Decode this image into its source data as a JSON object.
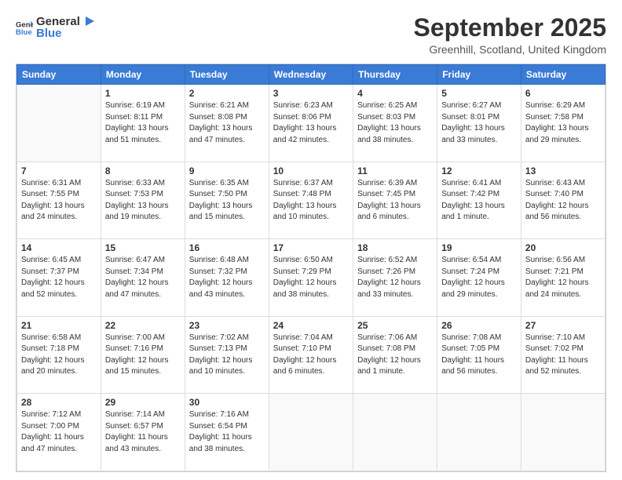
{
  "header": {
    "logo_general": "General",
    "logo_blue": "Blue",
    "title": "September 2025",
    "subtitle": "Greenhill, Scotland, United Kingdom"
  },
  "days": [
    "Sunday",
    "Monday",
    "Tuesday",
    "Wednesday",
    "Thursday",
    "Friday",
    "Saturday"
  ],
  "weeks": [
    [
      {
        "num": "",
        "sunrise": "",
        "sunset": "",
        "daylight": ""
      },
      {
        "num": "1",
        "sunrise": "Sunrise: 6:19 AM",
        "sunset": "Sunset: 8:11 PM",
        "daylight": "Daylight: 13 hours and 51 minutes."
      },
      {
        "num": "2",
        "sunrise": "Sunrise: 6:21 AM",
        "sunset": "Sunset: 8:08 PM",
        "daylight": "Daylight: 13 hours and 47 minutes."
      },
      {
        "num": "3",
        "sunrise": "Sunrise: 6:23 AM",
        "sunset": "Sunset: 8:06 PM",
        "daylight": "Daylight: 13 hours and 42 minutes."
      },
      {
        "num": "4",
        "sunrise": "Sunrise: 6:25 AM",
        "sunset": "Sunset: 8:03 PM",
        "daylight": "Daylight: 13 hours and 38 minutes."
      },
      {
        "num": "5",
        "sunrise": "Sunrise: 6:27 AM",
        "sunset": "Sunset: 8:01 PM",
        "daylight": "Daylight: 13 hours and 33 minutes."
      },
      {
        "num": "6",
        "sunrise": "Sunrise: 6:29 AM",
        "sunset": "Sunset: 7:58 PM",
        "daylight": "Daylight: 13 hours and 29 minutes."
      }
    ],
    [
      {
        "num": "7",
        "sunrise": "Sunrise: 6:31 AM",
        "sunset": "Sunset: 7:55 PM",
        "daylight": "Daylight: 13 hours and 24 minutes."
      },
      {
        "num": "8",
        "sunrise": "Sunrise: 6:33 AM",
        "sunset": "Sunset: 7:53 PM",
        "daylight": "Daylight: 13 hours and 19 minutes."
      },
      {
        "num": "9",
        "sunrise": "Sunrise: 6:35 AM",
        "sunset": "Sunset: 7:50 PM",
        "daylight": "Daylight: 13 hours and 15 minutes."
      },
      {
        "num": "10",
        "sunrise": "Sunrise: 6:37 AM",
        "sunset": "Sunset: 7:48 PM",
        "daylight": "Daylight: 13 hours and 10 minutes."
      },
      {
        "num": "11",
        "sunrise": "Sunrise: 6:39 AM",
        "sunset": "Sunset: 7:45 PM",
        "daylight": "Daylight: 13 hours and 6 minutes."
      },
      {
        "num": "12",
        "sunrise": "Sunrise: 6:41 AM",
        "sunset": "Sunset: 7:42 PM",
        "daylight": "Daylight: 13 hours and 1 minute."
      },
      {
        "num": "13",
        "sunrise": "Sunrise: 6:43 AM",
        "sunset": "Sunset: 7:40 PM",
        "daylight": "Daylight: 12 hours and 56 minutes."
      }
    ],
    [
      {
        "num": "14",
        "sunrise": "Sunrise: 6:45 AM",
        "sunset": "Sunset: 7:37 PM",
        "daylight": "Daylight: 12 hours and 52 minutes."
      },
      {
        "num": "15",
        "sunrise": "Sunrise: 6:47 AM",
        "sunset": "Sunset: 7:34 PM",
        "daylight": "Daylight: 12 hours and 47 minutes."
      },
      {
        "num": "16",
        "sunrise": "Sunrise: 6:48 AM",
        "sunset": "Sunset: 7:32 PM",
        "daylight": "Daylight: 12 hours and 43 minutes."
      },
      {
        "num": "17",
        "sunrise": "Sunrise: 6:50 AM",
        "sunset": "Sunset: 7:29 PM",
        "daylight": "Daylight: 12 hours and 38 minutes."
      },
      {
        "num": "18",
        "sunrise": "Sunrise: 6:52 AM",
        "sunset": "Sunset: 7:26 PM",
        "daylight": "Daylight: 12 hours and 33 minutes."
      },
      {
        "num": "19",
        "sunrise": "Sunrise: 6:54 AM",
        "sunset": "Sunset: 7:24 PM",
        "daylight": "Daylight: 12 hours and 29 minutes."
      },
      {
        "num": "20",
        "sunrise": "Sunrise: 6:56 AM",
        "sunset": "Sunset: 7:21 PM",
        "daylight": "Daylight: 12 hours and 24 minutes."
      }
    ],
    [
      {
        "num": "21",
        "sunrise": "Sunrise: 6:58 AM",
        "sunset": "Sunset: 7:18 PM",
        "daylight": "Daylight: 12 hours and 20 minutes."
      },
      {
        "num": "22",
        "sunrise": "Sunrise: 7:00 AM",
        "sunset": "Sunset: 7:16 PM",
        "daylight": "Daylight: 12 hours and 15 minutes."
      },
      {
        "num": "23",
        "sunrise": "Sunrise: 7:02 AM",
        "sunset": "Sunset: 7:13 PM",
        "daylight": "Daylight: 12 hours and 10 minutes."
      },
      {
        "num": "24",
        "sunrise": "Sunrise: 7:04 AM",
        "sunset": "Sunset: 7:10 PM",
        "daylight": "Daylight: 12 hours and 6 minutes."
      },
      {
        "num": "25",
        "sunrise": "Sunrise: 7:06 AM",
        "sunset": "Sunset: 7:08 PM",
        "daylight": "Daylight: 12 hours and 1 minute."
      },
      {
        "num": "26",
        "sunrise": "Sunrise: 7:08 AM",
        "sunset": "Sunset: 7:05 PM",
        "daylight": "Daylight: 11 hours and 56 minutes."
      },
      {
        "num": "27",
        "sunrise": "Sunrise: 7:10 AM",
        "sunset": "Sunset: 7:02 PM",
        "daylight": "Daylight: 11 hours and 52 minutes."
      }
    ],
    [
      {
        "num": "28",
        "sunrise": "Sunrise: 7:12 AM",
        "sunset": "Sunset: 7:00 PM",
        "daylight": "Daylight: 11 hours and 47 minutes."
      },
      {
        "num": "29",
        "sunrise": "Sunrise: 7:14 AM",
        "sunset": "Sunset: 6:57 PM",
        "daylight": "Daylight: 11 hours and 43 minutes."
      },
      {
        "num": "30",
        "sunrise": "Sunrise: 7:16 AM",
        "sunset": "Sunset: 6:54 PM",
        "daylight": "Daylight: 11 hours and 38 minutes."
      },
      {
        "num": "",
        "sunrise": "",
        "sunset": "",
        "daylight": ""
      },
      {
        "num": "",
        "sunrise": "",
        "sunset": "",
        "daylight": ""
      },
      {
        "num": "",
        "sunrise": "",
        "sunset": "",
        "daylight": ""
      },
      {
        "num": "",
        "sunrise": "",
        "sunset": "",
        "daylight": ""
      }
    ]
  ]
}
